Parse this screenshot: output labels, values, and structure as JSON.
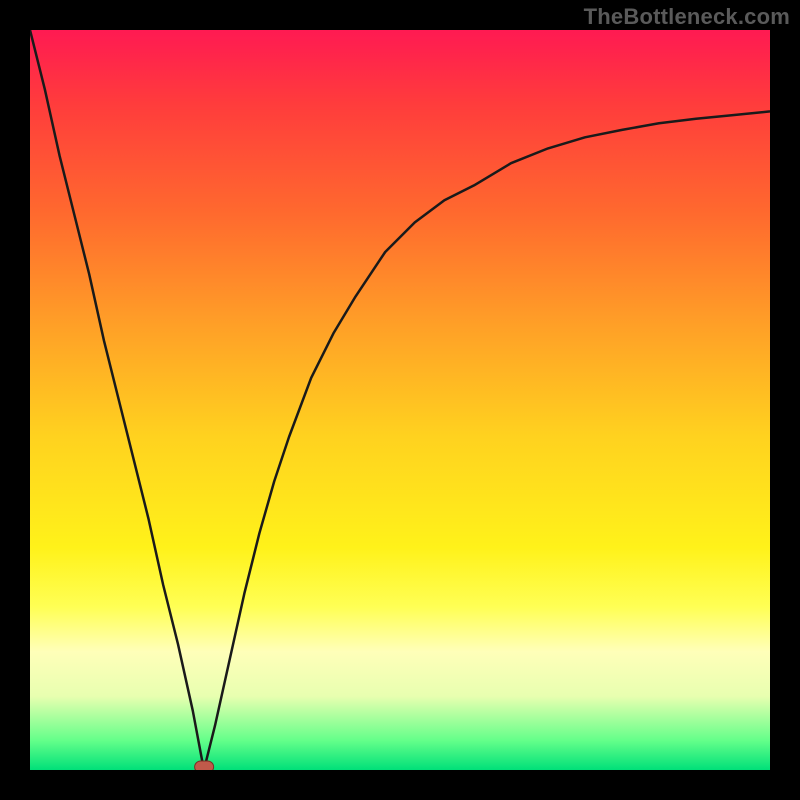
{
  "watermark": "TheBottleneck.com",
  "colors": {
    "frame": "#000000",
    "marker_fill": "#c05a4a",
    "marker_stroke": "#7b2f24",
    "curve": "#1a1a1a",
    "gradient_stops": [
      "#ff1a52",
      "#ff3c3c",
      "#ff6a2e",
      "#ffa027",
      "#ffd21f",
      "#fff21a",
      "#ffff55",
      "#ffffb9",
      "#e8ffb0",
      "#64ff8a",
      "#00e079"
    ],
    "gradient_positions": [
      0,
      10,
      25,
      40,
      55,
      70,
      78,
      84,
      90,
      96,
      100
    ]
  },
  "chart_data": {
    "type": "line",
    "title": "",
    "xlabel": "",
    "ylabel": "",
    "xlim": [
      0,
      100
    ],
    "ylim": [
      0,
      100
    ],
    "x": [
      0,
      2,
      4,
      6,
      8,
      10,
      12,
      14,
      16,
      18,
      20,
      22,
      23.5,
      25,
      27,
      29,
      31,
      33,
      35,
      38,
      41,
      44,
      48,
      52,
      56,
      60,
      65,
      70,
      75,
      80,
      85,
      90,
      95,
      100
    ],
    "values": [
      100,
      92,
      83,
      75,
      67,
      58,
      50,
      42,
      34,
      25,
      17,
      8,
      0,
      6,
      15,
      24,
      32,
      39,
      45,
      53,
      59,
      64,
      70,
      74,
      77,
      79,
      82,
      84,
      85.5,
      86.5,
      87.4,
      88,
      88.5,
      89
    ],
    "marker": {
      "x": 23.5,
      "y": 0,
      "w_pct": 2.4,
      "h_pct": 1.5
    }
  }
}
